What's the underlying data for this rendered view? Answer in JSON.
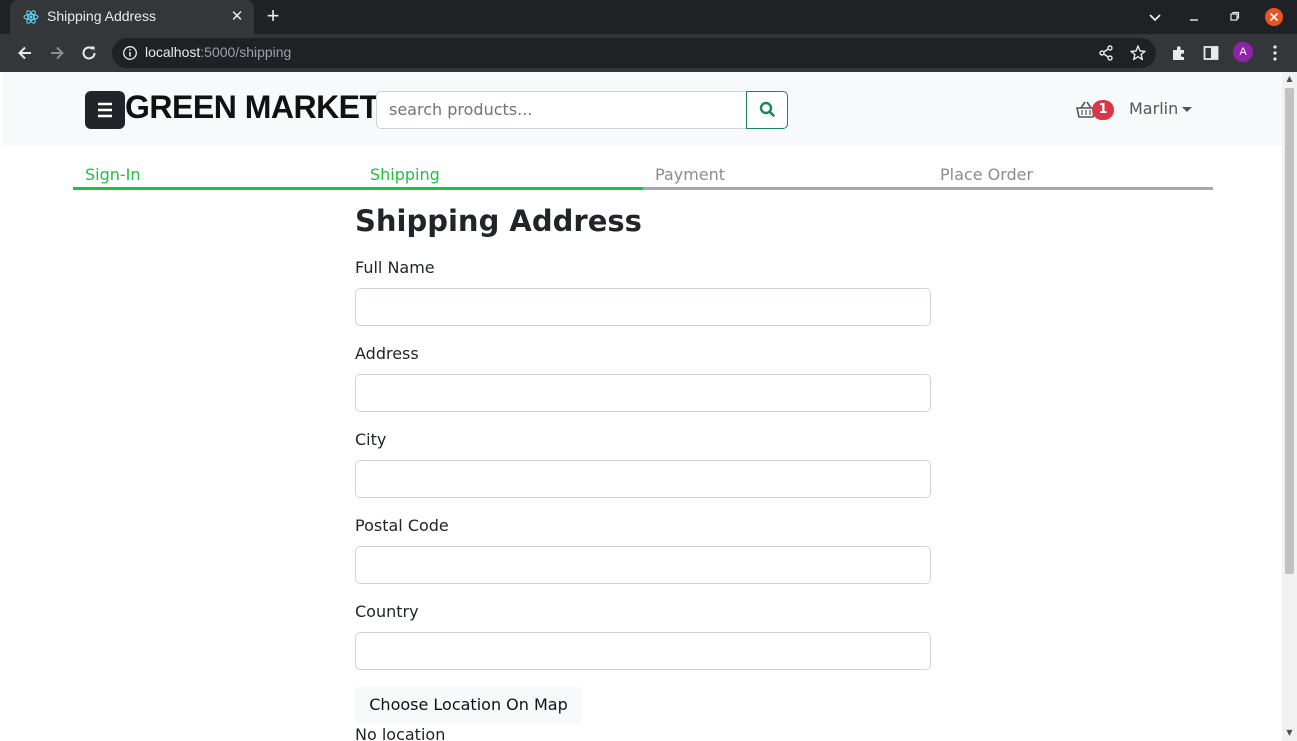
{
  "browser": {
    "tab_title": "Shipping Address",
    "url_host": "localhost",
    "url_rest": ":5000/shipping",
    "profile_initial": "A",
    "colors": {
      "chrome_dark": "#202124",
      "toolbar": "#35363a",
      "close_accent": "#e95420"
    }
  },
  "navbar": {
    "brand": "GREEN MARKET",
    "search_placeholder": "search products...",
    "cart_count": "1",
    "user_name": "Marlin"
  },
  "steps": [
    {
      "label": "Sign-In",
      "active": true
    },
    {
      "label": "Shipping",
      "active": true
    },
    {
      "label": "Payment",
      "active": false
    },
    {
      "label": "Place Order",
      "active": false
    }
  ],
  "form": {
    "title": "Shipping Address",
    "fields": [
      {
        "label": "Full Name",
        "value": ""
      },
      {
        "label": "Address",
        "value": ""
      },
      {
        "label": "City",
        "value": ""
      },
      {
        "label": "Postal Code",
        "value": ""
      },
      {
        "label": "Country",
        "value": ""
      }
    ],
    "map_button": "Choose Location On Map",
    "location_status": "No location"
  },
  "colors": {
    "step_active": "#20c040",
    "step_inactive": "#a8a8a8",
    "search_button_border": "#198754",
    "cart_badge": "#dc3545"
  }
}
